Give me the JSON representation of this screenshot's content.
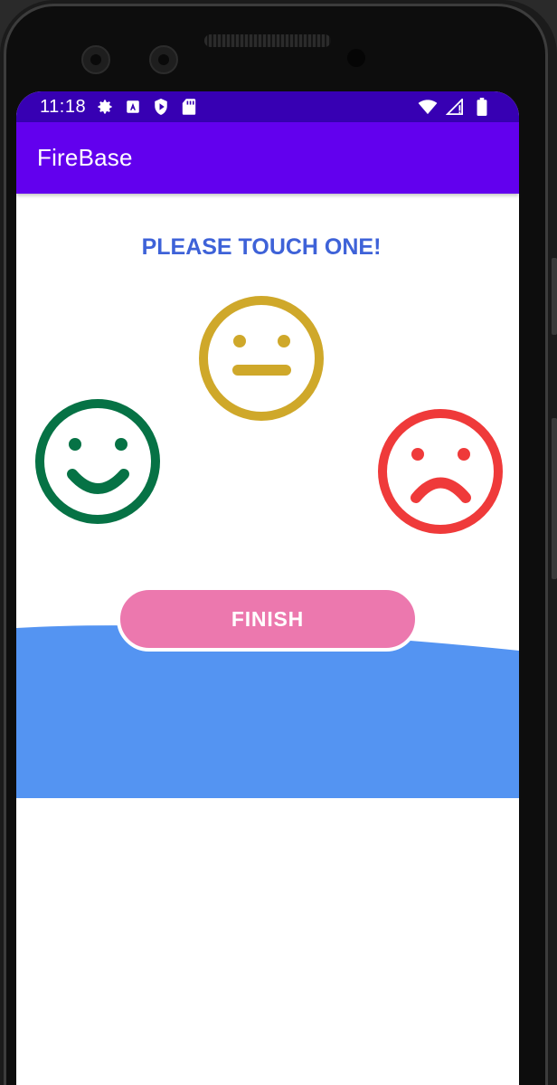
{
  "status_bar": {
    "time": "11:18",
    "left_icons": [
      "settings-icon",
      "accessibility-icon",
      "shield-play-icon",
      "sd-card-icon"
    ],
    "right_icons": [
      "wifi-icon",
      "cell-signal-icon",
      "battery-icon"
    ]
  },
  "app_bar": {
    "title": "FireBase"
  },
  "main": {
    "prompt": "PLEASE TOUCH ONE!",
    "faces": [
      {
        "name": "neutral",
        "icon": "neutral-face-icon",
        "color": "#cfa82a"
      },
      {
        "name": "happy",
        "icon": "happy-face-icon",
        "color": "#067245"
      },
      {
        "name": "sad",
        "icon": "sad-face-icon",
        "color": "#ef3a3a"
      }
    ],
    "finish_label": "FINISH"
  },
  "colors": {
    "status_bar": "#3700b3",
    "app_bar": "#6200ee",
    "prompt": "#3e62d8",
    "button": "#ec78ae",
    "wave": "#5494f2"
  }
}
